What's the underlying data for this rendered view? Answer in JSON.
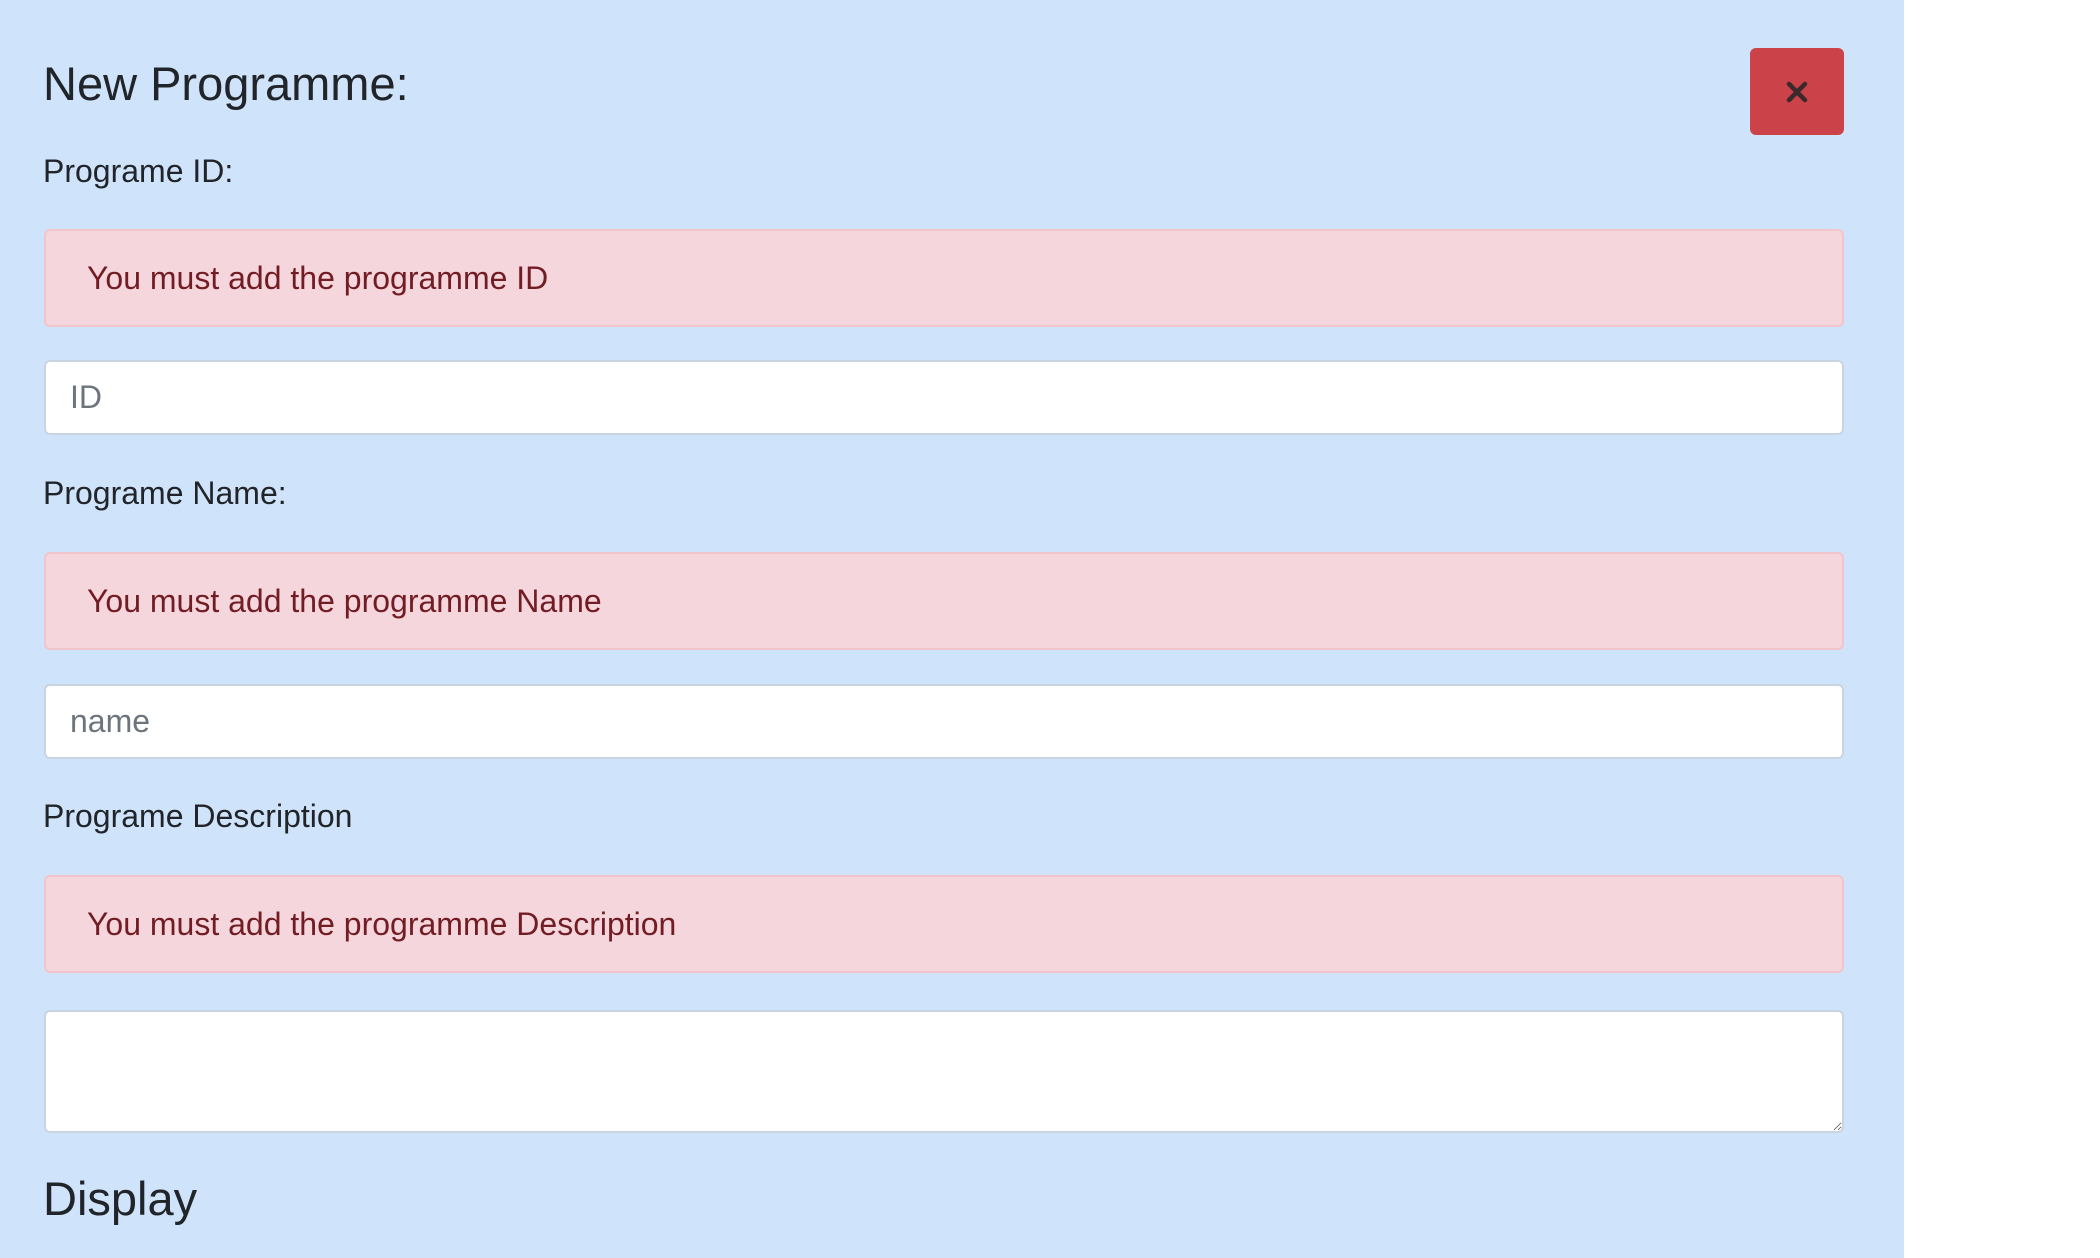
{
  "form": {
    "title": "New Programme:",
    "close_icon": "close-icon",
    "fields": {
      "id": {
        "label": "Programe ID:",
        "error": "You must add the programme ID",
        "placeholder": "ID",
        "value": ""
      },
      "name": {
        "label": "Programe Name:",
        "error": "You must add the programme Name",
        "placeholder": "name",
        "value": ""
      },
      "description": {
        "label": "Programe Description",
        "error": "You must add the programme Description",
        "value": ""
      }
    },
    "display_heading": "Display"
  },
  "colors": {
    "panel_bg": "#cfe3fb",
    "close_button": "#cc4249",
    "alert_bg": "#f4d6dc",
    "alert_text": "#721c24"
  }
}
